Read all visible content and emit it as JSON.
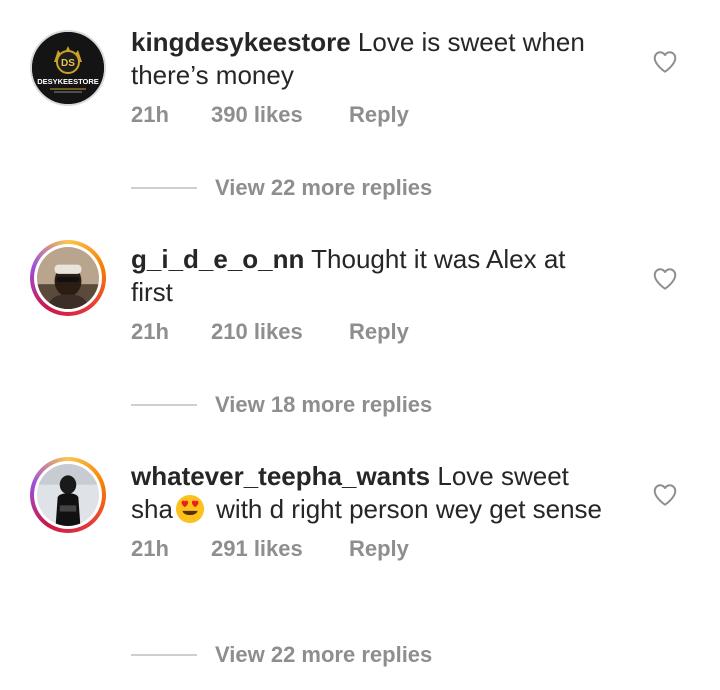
{
  "comments": [
    {
      "username": "kingdesykeestore",
      "text": " Love is sweet when there’s money",
      "time": "21h",
      "likes": "390 likes",
      "reply": "Reply",
      "view_replies": "View 22 more replies",
      "avatar_logo_text": "DS",
      "avatar_store_text": "DESYKEESTORE",
      "avatar_icon": "store-logo"
    },
    {
      "username": "g_i_d_e_o_nn",
      "text": " Thought it was Alex at first",
      "time": "21h",
      "likes": "210 likes",
      "reply": "Reply",
      "view_replies": "View 18 more replies",
      "avatar_icon": "user-photo"
    },
    {
      "username": "whatever_teepha_wants",
      "text_before_emoji": " Love sweet sha",
      "emoji": "heart-eyes-emoji",
      "text_after_emoji": " with d right person wey get sense",
      "time": "21h",
      "likes": "291 likes",
      "reply": "Reply",
      "view_replies": "View 22 more replies",
      "avatar_icon": "user-photo"
    }
  ],
  "colors": {
    "text": "#262626",
    "meta": "#8e8e8e",
    "divider": "#cfcfcf",
    "story_ring": [
      "#f9c74f",
      "#f77f00",
      "#e5383b",
      "#c9184a",
      "#9d4edd"
    ]
  }
}
